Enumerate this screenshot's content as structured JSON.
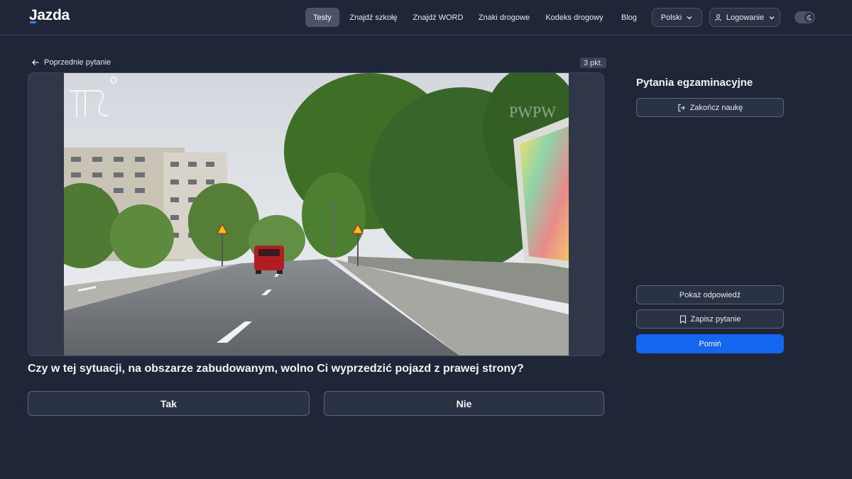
{
  "header": {
    "logo": "Jazda",
    "nav": [
      {
        "label": "Testy",
        "active": true
      },
      {
        "label": "Znajdź szkołę"
      },
      {
        "label": "Znajdź WORD"
      },
      {
        "label": "Znaki drogowe"
      },
      {
        "label": "Kodeks drogowy"
      },
      {
        "label": "Blog"
      }
    ],
    "language": "Polski",
    "login": "Logowanie"
  },
  "question": {
    "back_label": "Poprzednie pytanie",
    "points": "3 pkt.",
    "watermark_right": "PWPW",
    "text": "Czy w tej sytuacji, na obszarze zabudowanym, wolno Ci wyprzedzić pojazd z prawej strony?",
    "answers": [
      "Tak",
      "Nie"
    ]
  },
  "sidebar": {
    "title": "Pytania egzaminacyjne",
    "end_label": "Zakończ naukę",
    "show_answer_label": "Pokaż odpowiedź",
    "save_label": "Zapisz pytanie",
    "skip_label": "Pomiń"
  },
  "colors": {
    "background": "#1e2638",
    "accent": "#1466f0"
  }
}
